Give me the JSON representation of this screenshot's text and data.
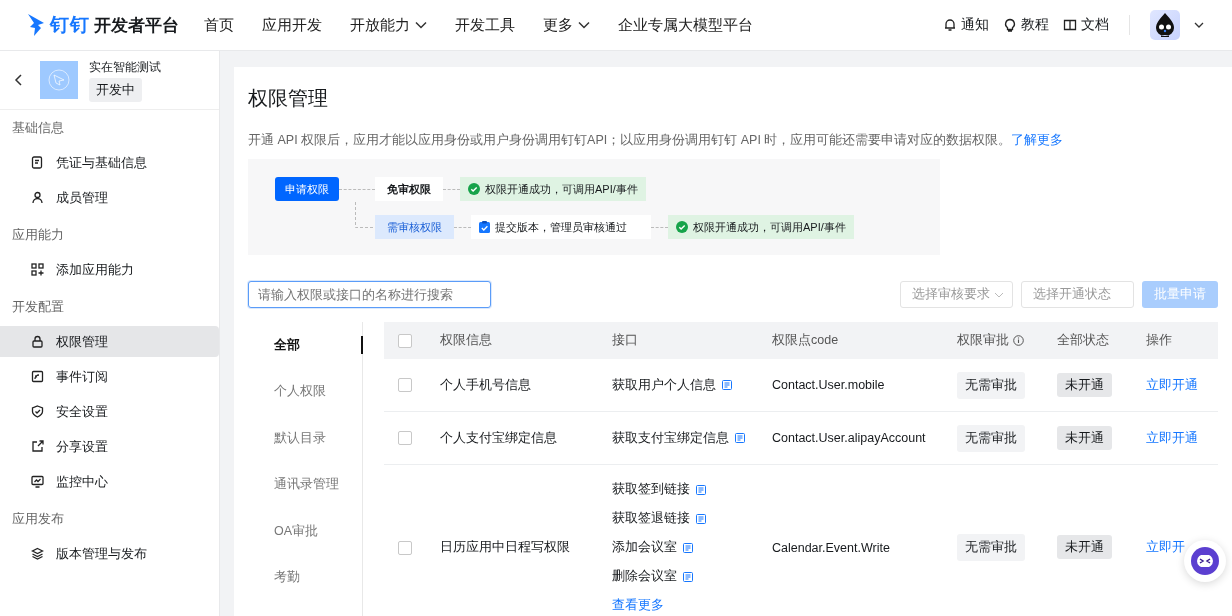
{
  "header": {
    "logo_text": "钉钉",
    "platform": "开发者平台",
    "nav": [
      {
        "label": "首页",
        "dropdown": false
      },
      {
        "label": "应用开发",
        "dropdown": false
      },
      {
        "label": "开放能力",
        "dropdown": true
      },
      {
        "label": "开发工具",
        "dropdown": false
      },
      {
        "label": "更多",
        "dropdown": true
      },
      {
        "label": "企业专属大模型平台",
        "dropdown": false
      }
    ],
    "links": [
      "通知",
      "教程",
      "文档"
    ]
  },
  "app": {
    "name": "实在智能测试",
    "status": "开发中"
  },
  "sidebar": [
    {
      "title": "基础信息",
      "items": [
        {
          "label": "凭证与基础信息",
          "selected": false
        },
        {
          "label": "成员管理",
          "selected": false
        }
      ]
    },
    {
      "title": "应用能力",
      "items": [
        {
          "label": "添加应用能力",
          "selected": false
        }
      ]
    },
    {
      "title": "开发配置",
      "items": [
        {
          "label": "权限管理",
          "selected": true
        },
        {
          "label": "事件订阅",
          "selected": false
        },
        {
          "label": "安全设置",
          "selected": false
        },
        {
          "label": "分享设置",
          "selected": false
        },
        {
          "label": "监控中心",
          "selected": false
        }
      ]
    },
    {
      "title": "应用发布",
      "items": [
        {
          "label": "版本管理与发布",
          "selected": false
        }
      ]
    }
  ],
  "page": {
    "title": "权限管理",
    "description": "开通 API 权限后，应用才能以应用身份或用户身份调用钉钉API；以应用身份调用钉钉 API 时，应用可能还需要申请对应的数据权限。",
    "learn_more": "了解更多"
  },
  "flow": {
    "start": "申请权限",
    "branches": [
      {
        "label": "免审权限",
        "kind": "free",
        "steps": [
          {
            "kind": "success",
            "text": "权限开通成功，可调用API/事件"
          }
        ]
      },
      {
        "label": "需审核权限",
        "kind": "review",
        "steps": [
          {
            "kind": "task",
            "text": "提交版本，管理员审核通过"
          },
          {
            "kind": "success",
            "text": "权限开通成功，可调用API/事件"
          }
        ]
      }
    ]
  },
  "filters": {
    "search": {
      "placeholder": "请输入权限或接口的名称进行搜索"
    },
    "review_select": {
      "placeholder": "选择审核要求"
    },
    "status_select": {
      "placeholder": "选择开通状态"
    },
    "batch_button": {
      "label": "批量申请",
      "disabled": true
    }
  },
  "categories": [
    {
      "label": "全部",
      "selected": true
    },
    {
      "label": "个人权限",
      "selected": false
    },
    {
      "label": "默认目录",
      "selected": false
    },
    {
      "label": "通讯录管理",
      "selected": false
    },
    {
      "label": "OA审批",
      "selected": false
    },
    {
      "label": "考勤",
      "selected": false
    }
  ],
  "table": {
    "all_checked": false,
    "columns": [
      {
        "label": "权限信息",
        "info": false
      },
      {
        "label": "接口",
        "info": false
      },
      {
        "label": "权限点code",
        "info": false
      },
      {
        "label": "权限审批",
        "info": true
      },
      {
        "label": "全部状态",
        "info": false
      },
      {
        "label": "操作",
        "info": false
      }
    ],
    "rows": [
      {
        "checked": false,
        "name": "个人手机号信息",
        "apis": [
          "获取用户个人信息"
        ],
        "more": null,
        "code": "Contact.User.mobile",
        "approval": "无需审批",
        "status": "未开通",
        "action": "立即开通"
      },
      {
        "checked": false,
        "name": "个人支付宝绑定信息",
        "apis": [
          "获取支付宝绑定信息"
        ],
        "more": null,
        "code": "Contact.User.alipayAccount",
        "approval": "无需审批",
        "status": "未开通",
        "action": "立即开通"
      },
      {
        "checked": false,
        "name": "日历应用中日程写权限",
        "apis": [
          "获取签到链接",
          "获取签退链接",
          "添加会议室",
          "删除会议室"
        ],
        "more": "查看更多",
        "code": "Calendar.Event.Write",
        "approval": "无需审批",
        "status": "未开通",
        "action": "立即开"
      }
    ]
  }
}
